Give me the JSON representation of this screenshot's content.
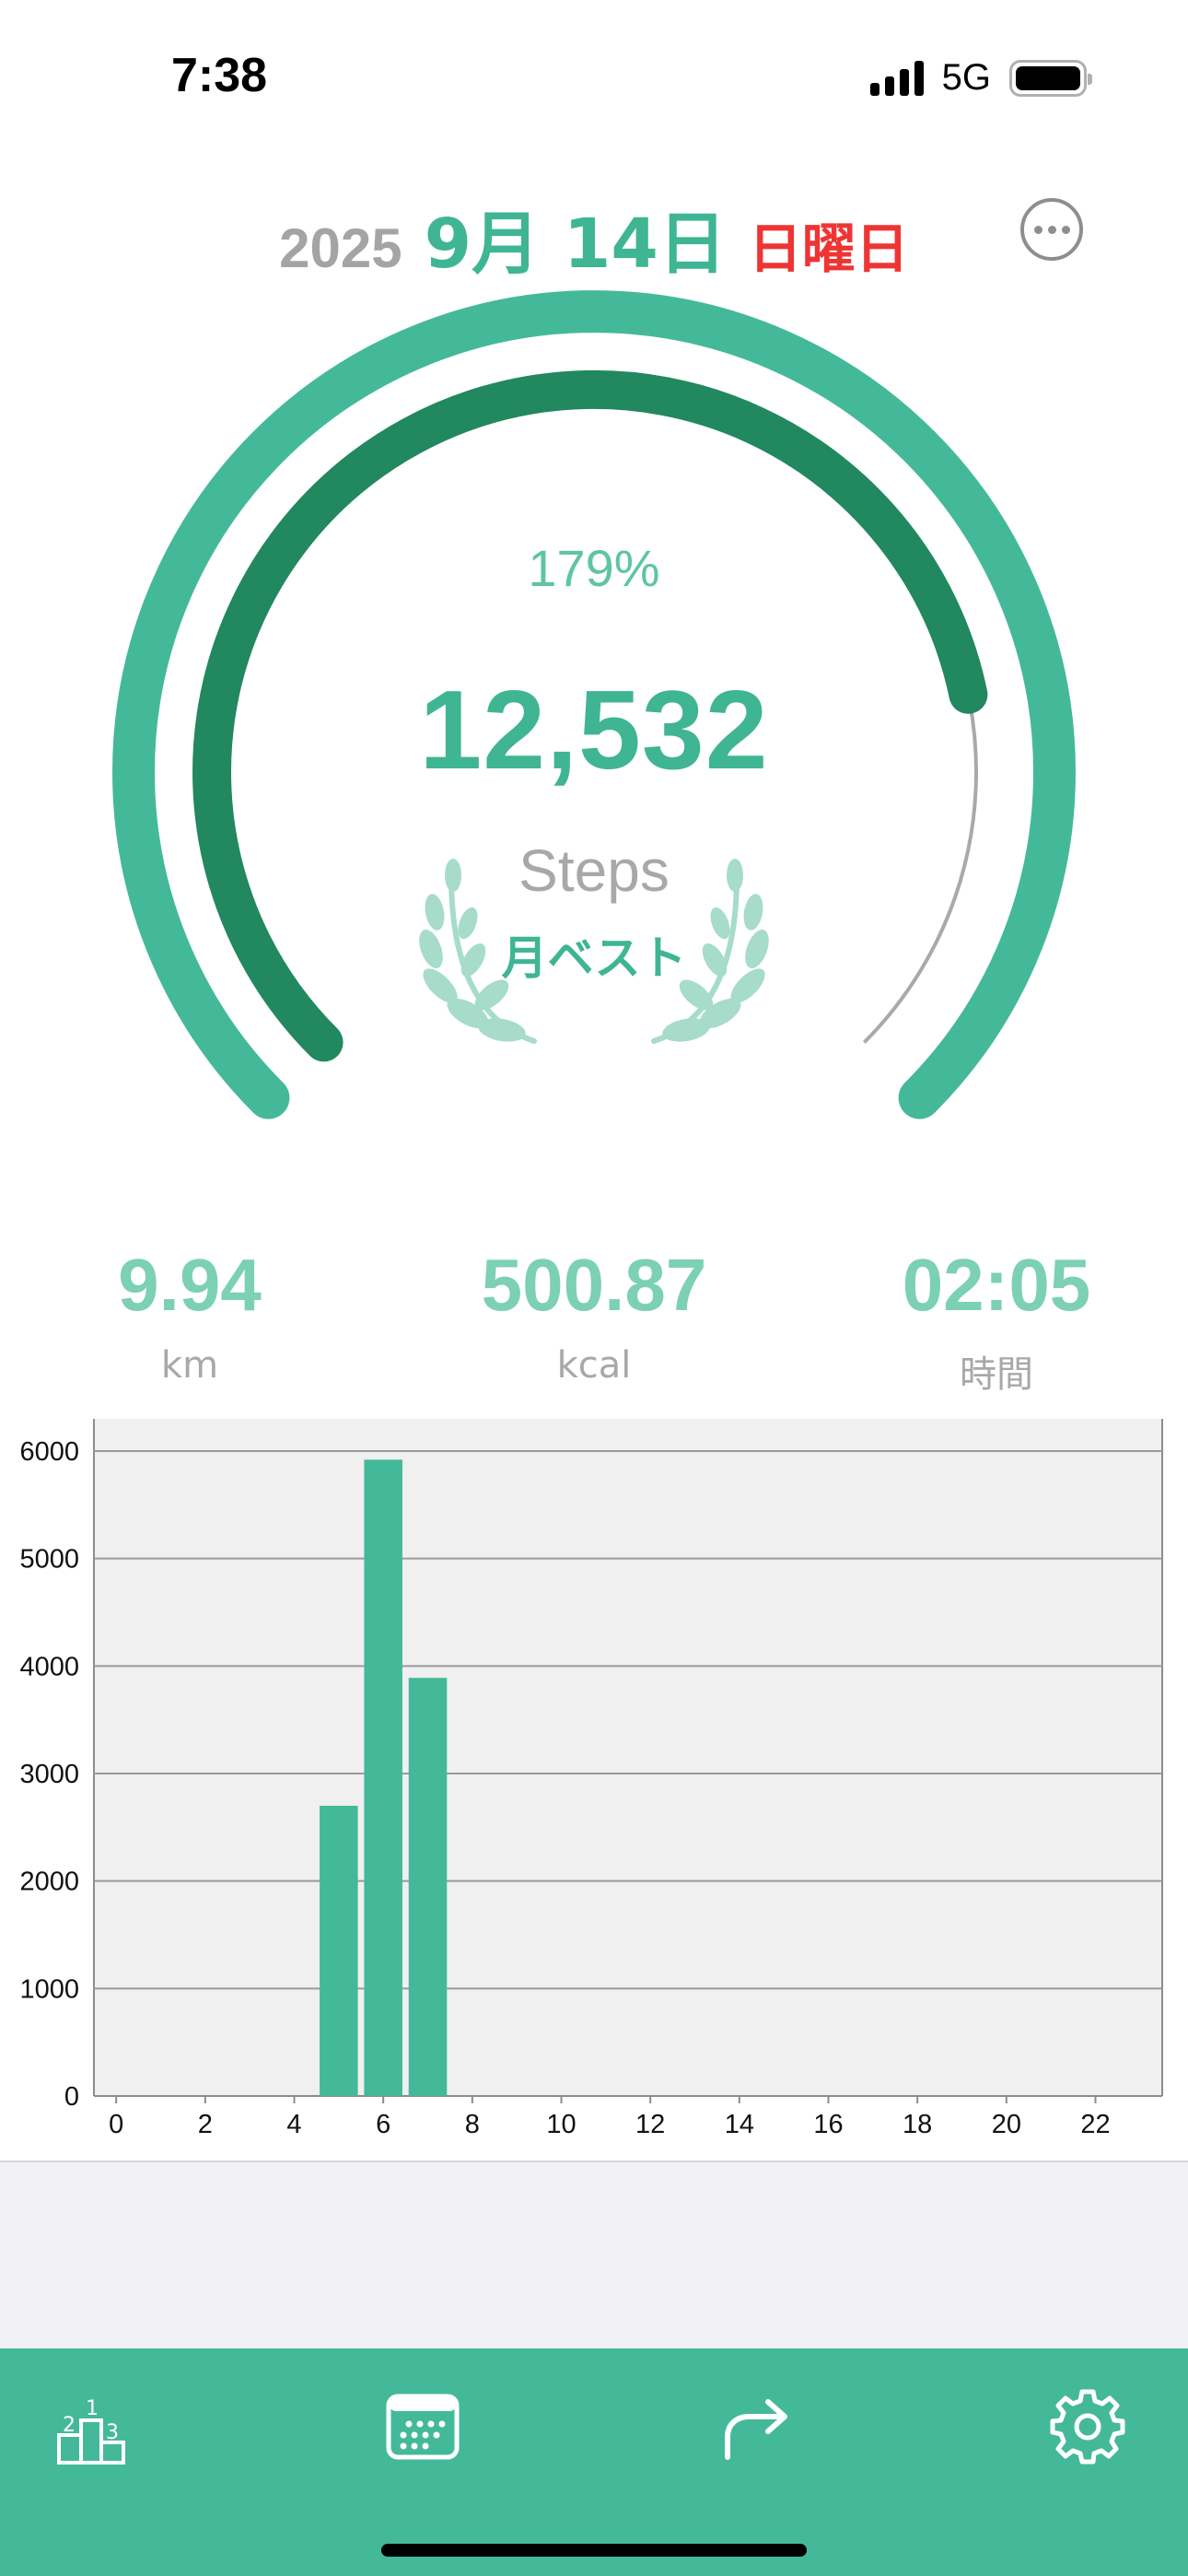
{
  "status_bar": {
    "time": "7:38",
    "network": "5G",
    "battery_level": 1.0
  },
  "header": {
    "year": "2025",
    "month_day": "9月 14日",
    "weekday": "日曜日",
    "weekday_color": "#ee3534",
    "more_icon": "ellipsis-circle-icon"
  },
  "gauge": {
    "percent_label": "179%",
    "steps": "12,532",
    "unit": "Steps",
    "badge": "月ベスト",
    "badge_icon": "laurel-wreath-icon",
    "outer_progress": 1.0,
    "inner_progress": 0.79,
    "outer_color": "#44b99a",
    "inner_color": "#21885f",
    "track_color": "#a9a9a9"
  },
  "stats": [
    {
      "value": "9.94",
      "label": "km"
    },
    {
      "value": "500.87",
      "label": "kcal"
    },
    {
      "value": "02:05",
      "label": "時間"
    }
  ],
  "chart_data": {
    "type": "bar",
    "x_ticks": [
      "0",
      "2",
      "4",
      "6",
      "8",
      "10",
      "12",
      "14",
      "16",
      "18",
      "20",
      "22"
    ],
    "y_ticks": [
      "0",
      "1000",
      "2000",
      "3000",
      "4000",
      "5000",
      "6000"
    ],
    "ylim": [
      0,
      6300
    ],
    "xlim": [
      -0.5,
      23.5
    ],
    "hours": [
      5,
      6,
      7
    ],
    "values": [
      2700,
      5920,
      3890
    ],
    "bar_color": "#44b99a",
    "background": "#f0f0f0",
    "grid": true
  },
  "tab_bar": {
    "items": [
      {
        "icon": "podium-ranking-icon"
      },
      {
        "icon": "calendar-icon"
      },
      {
        "icon": "share-arrow-icon"
      },
      {
        "icon": "gear-icon"
      }
    ],
    "color": "#44b99a"
  }
}
